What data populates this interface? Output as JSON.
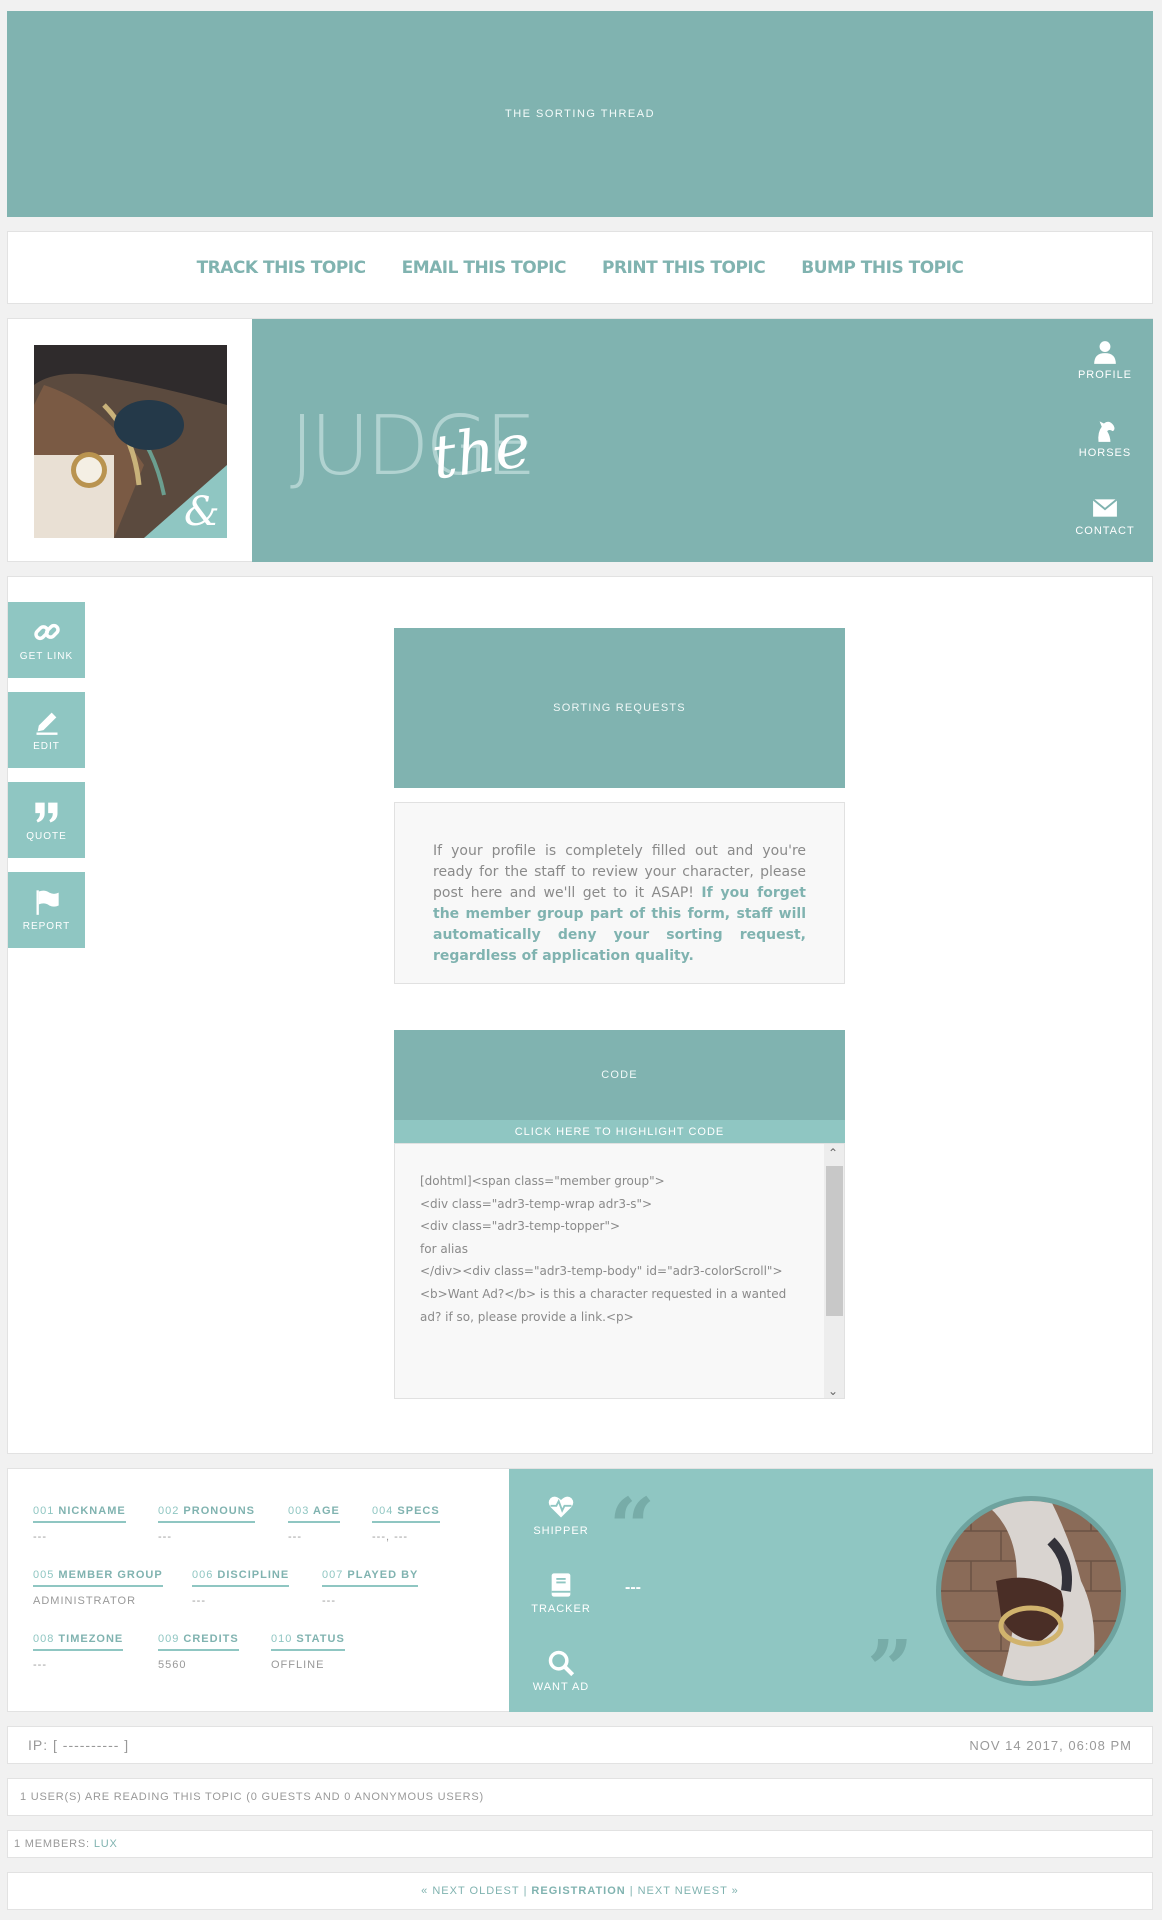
{
  "header": {
    "title": "THE SORTING THREAD"
  },
  "topic_actions": [
    "TRACK THIS TOPIC",
    "EMAIL THIS TOPIC",
    "PRINT THIS TOPIC",
    "BUMP THIS TOPIC"
  ],
  "profile": {
    "banner_word": "JUDGE",
    "banner_script": "the",
    "side_links": [
      "PROFILE",
      "HORSES",
      "CONTACT"
    ]
  },
  "post_buttons": [
    "GET LINK",
    "EDIT",
    "QUOTE",
    "REPORT"
  ],
  "sorting": {
    "header": "SORTING REQUESTS",
    "body_plain": "If your profile is completely filled out and you're ready for the staff to review your character, please post here and we'll get to it ASAP! ",
    "body_bold": "If you forget the member group part of this form, staff will automatically deny your sorting request, regardless of application quality."
  },
  "code": {
    "header": "CODE",
    "highlight": "CLICK HERE TO HIGHLIGHT CODE",
    "lines": [
      "[dohtml]<span class=\"member group\">",
      "<div class=\"adr3-temp-wrap adr3-s\">",
      "<div class=\"adr3-temp-topper\">",
      "",
      "for alias",
      "",
      "</div><div class=\"adr3-temp-body\" id=\"adr3-colorScroll\">",
      "",
      "<b>Want Ad?</b> is this a character requested in a wanted ad? if so, please provide a link.<p>"
    ]
  },
  "member_info": {
    "fields": [
      {
        "num": "001",
        "label": "NICKNAME",
        "value": "---"
      },
      {
        "num": "002",
        "label": "PRONOUNS",
        "value": "---"
      },
      {
        "num": "003",
        "label": "AGE",
        "value": "---"
      },
      {
        "num": "004",
        "label": "SPECS",
        "value": "---, ---"
      },
      {
        "num": "005",
        "label": "MEMBER GROUP",
        "value": "ADMINISTRATOR"
      },
      {
        "num": "006",
        "label": "DISCIPLINE",
        "value": "---"
      },
      {
        "num": "007",
        "label": "PLAYED BY",
        "value": "---"
      },
      {
        "num": "008",
        "label": "TIMEZONE",
        "value": "---"
      },
      {
        "num": "009",
        "label": "CREDITS",
        "value": "5560"
      },
      {
        "num": "010",
        "label": "STATUS",
        "value": "OFFLINE"
      }
    ],
    "icons": [
      "SHIPPER",
      "TRACKER",
      "WANT AD"
    ],
    "quote_text": "---"
  },
  "footer": {
    "ip": "IP: [ ---------- ]",
    "date": "NOV 14 2017, 06:08 PM",
    "reading": "1 USER(S) ARE READING THIS TOPIC (0 GUESTS AND 0 ANONYMOUS USERS)",
    "members_prefix": "1 MEMBERS: ",
    "members_name": "LUX",
    "nav_prev": "« NEXT OLDEST",
    "nav_sep": "|",
    "nav_reg": "REGISTRATION",
    "nav_next": "NEXT NEWEST »"
  }
}
